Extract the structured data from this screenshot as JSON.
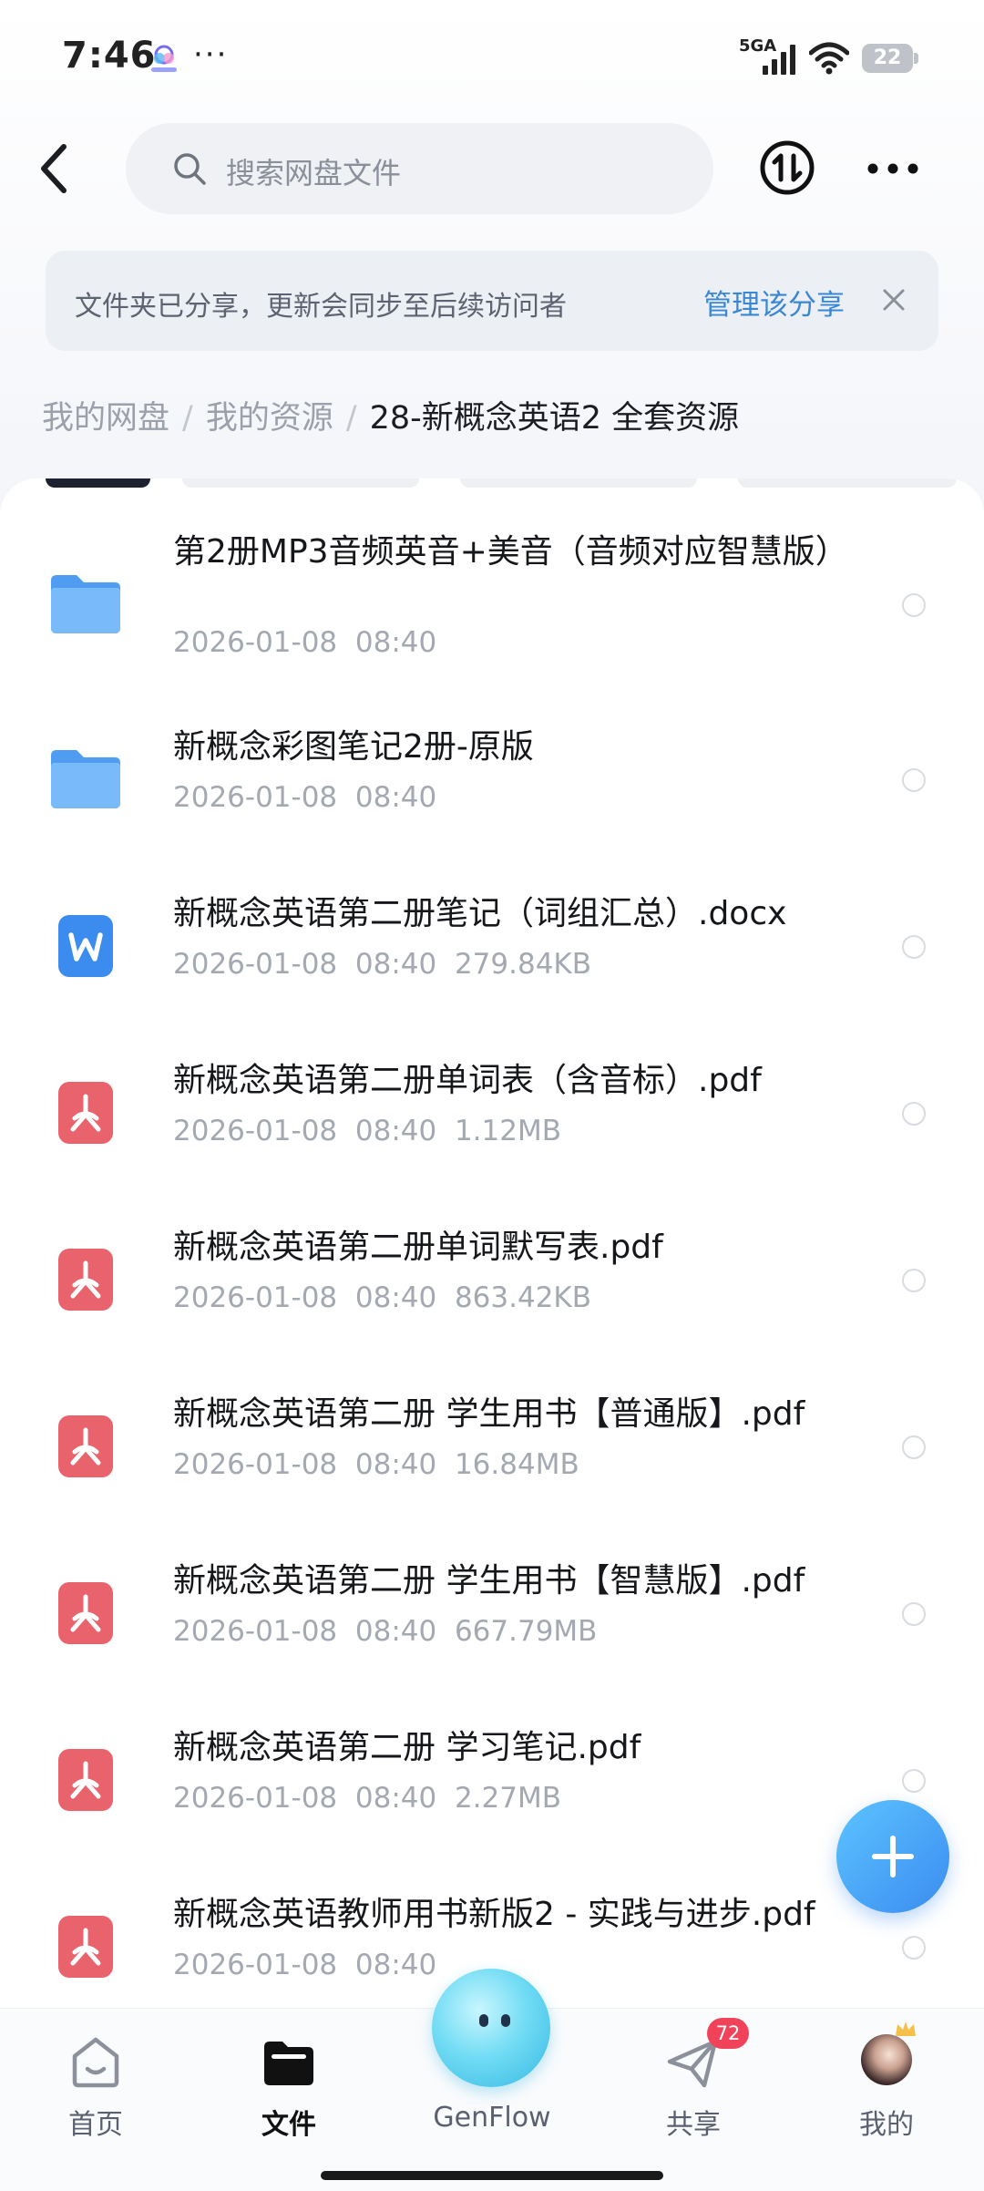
{
  "status_bar": {
    "time": "7:46",
    "dots": "···",
    "network": "5GA",
    "battery": "22"
  },
  "header": {
    "search_placeholder": "搜索网盘文件",
    "transfer_icon": "transfer-updown-icon",
    "more_icon": "more-dots-icon"
  },
  "share_banner": {
    "text": "文件夹已分享，更新会同步至后续访问者",
    "link": "管理该分享"
  },
  "breadcrumb": {
    "items": [
      "我的网盘",
      "我的资源"
    ],
    "separator": "/",
    "current": "28-新概念英语2 全套资源"
  },
  "files": [
    {
      "type": "folder",
      "name": "第2册MP3音频英音+美音（音频对应智慧版）",
      "date": "2026-01-08",
      "time": "08:40",
      "size": ""
    },
    {
      "type": "folder",
      "name": "新概念彩图笔记2册-原版",
      "date": "2026-01-08",
      "time": "08:40",
      "size": ""
    },
    {
      "type": "word",
      "name": "新概念英语第二册笔记（词组汇总）.docx",
      "date": "2026-01-08",
      "time": "08:40",
      "size": "279.84KB"
    },
    {
      "type": "pdf",
      "name": "新概念英语第二册单词表（含音标）.pdf",
      "date": "2026-01-08",
      "time": "08:40",
      "size": "1.12MB"
    },
    {
      "type": "pdf",
      "name": "新概念英语第二册单词默写表.pdf",
      "date": "2026-01-08",
      "time": "08:40",
      "size": "863.42KB"
    },
    {
      "type": "pdf",
      "name": "新概念英语第二册 学生用书【普通版】.pdf",
      "date": "2026-01-08",
      "time": "08:40",
      "size": "16.84MB"
    },
    {
      "type": "pdf",
      "name": "新概念英语第二册 学生用书【智慧版】.pdf",
      "date": "2026-01-08",
      "time": "08:40",
      "size": "667.79MB"
    },
    {
      "type": "pdf",
      "name": "新概念英语第二册 学习笔记.pdf",
      "date": "2026-01-08",
      "time": "08:40",
      "size": "2.27MB"
    },
    {
      "type": "pdf",
      "name": "新概念英语教师用书新版2 - 实践与进步.pdf",
      "date": "2026-01-08",
      "time": "08:40",
      "size": ""
    }
  ],
  "fab": {
    "icon": "plus-icon"
  },
  "bottom_nav": {
    "items": [
      {
        "label": "首页",
        "icon": "home-icon",
        "active": false
      },
      {
        "label": "文件",
        "icon": "folder-icon",
        "active": true
      },
      {
        "label": "GenFlow",
        "icon": "genflow-orb-icon",
        "active": false
      },
      {
        "label": "共享",
        "icon": "paper-plane-icon",
        "active": false,
        "badge": "72"
      },
      {
        "label": "我的",
        "icon": "avatar-icon",
        "active": false
      }
    ]
  },
  "colors": {
    "accent": "#3a87d6",
    "folder": "#5aa9f5",
    "word": "#3c8cf0",
    "pdf": "#e9636d",
    "badge": "#f0435a"
  }
}
